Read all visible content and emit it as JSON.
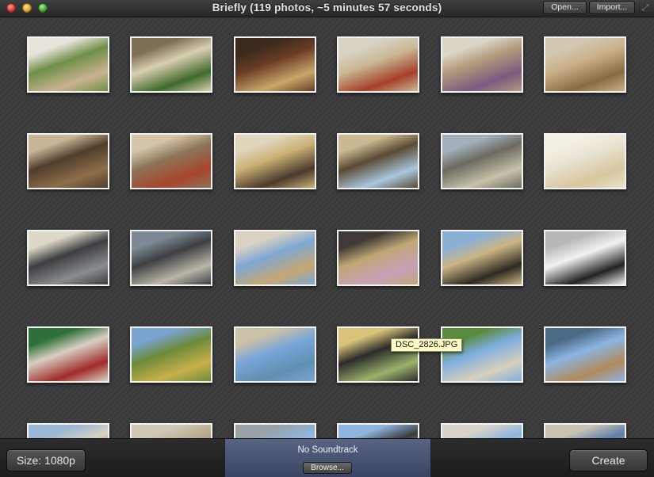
{
  "window": {
    "title": "Briefly (119 photos, ~5 minutes 57 seconds)",
    "open_label": "Open...",
    "import_label": "Import..."
  },
  "tooltip": "DSC_2826.JPG",
  "photos": [
    {
      "colors": [
        "#6f8f48",
        "#c9b390",
        "#e8e4dc"
      ]
    },
    {
      "colors": [
        "#d9cfb2",
        "#3f6a2a",
        "#7c6f55"
      ]
    },
    {
      "colors": [
        "#6a3c25",
        "#c8a76a",
        "#3c2a1d"
      ]
    },
    {
      "colors": [
        "#c9b894",
        "#a5402a",
        "#d8d2c4"
      ]
    },
    {
      "colors": [
        "#b19a7a",
        "#7a5a80",
        "#dcd6c8"
      ]
    },
    {
      "colors": [
        "#c9b089",
        "#8a6a42",
        "#d2c7b0"
      ]
    },
    {
      "colors": [
        "#4f3d2b",
        "#8e6e4a",
        "#c7b597"
      ]
    },
    {
      "colors": [
        "#8b7558",
        "#a8452d",
        "#d4c4ab"
      ]
    },
    {
      "colors": [
        "#cab175",
        "#4a3a2b",
        "#e0d6bd"
      ]
    },
    {
      "colors": [
        "#5a4a34",
        "#a9c7de",
        "#cbb993"
      ]
    },
    {
      "colors": [
        "#6c6a60",
        "#c8c2aa",
        "#a3b0bc"
      ]
    },
    {
      "colors": [
        "#e7e1cf",
        "#d8c69d",
        "#f3efe3"
      ]
    },
    {
      "colors": [
        "#3c3e40",
        "#8a8d90",
        "#ddd8c8"
      ]
    },
    {
      "colors": [
        "#3d3f42",
        "#b9b6a8",
        "#7d8a95"
      ]
    },
    {
      "colors": [
        "#7fa7d4",
        "#c6a774",
        "#d9d2c2"
      ]
    },
    {
      "colors": [
        "#bfa774",
        "#c8a0b8",
        "#3f3a35"
      ]
    },
    {
      "colors": [
        "#cbb585",
        "#2d2a22",
        "#8ab0d6"
      ]
    },
    {
      "colors": [
        "#f2f2f0",
        "#222222",
        "#b8b8b8"
      ]
    },
    {
      "colors": [
        "#d7d0c2",
        "#a02a2a",
        "#2f6f3a"
      ]
    },
    {
      "colors": [
        "#6c8a3a",
        "#c8b04a",
        "#7aa3cf"
      ]
    },
    {
      "colors": [
        "#7aa5d8",
        "#5f8fb0",
        "#c9c1a8"
      ]
    },
    {
      "colors": [
        "#2b2b2b",
        "#9ab26a",
        "#d9c37a"
      ]
    },
    {
      "colors": [
        "#7faedf",
        "#d8cfbd",
        "#5a8a3e"
      ]
    },
    {
      "colors": [
        "#8cb4e2",
        "#b08a5a",
        "#4a6a86"
      ]
    },
    {
      "colors": [
        "#d8d2c2",
        "#7a6a55",
        "#9bb7d4"
      ]
    },
    {
      "colors": [
        "#b7a98a",
        "#6a7a8a",
        "#cfc8b5"
      ]
    },
    {
      "colors": [
        "#8fb5df",
        "#d8d3c5",
        "#9aa2a8"
      ]
    },
    {
      "colors": [
        "#3a3a3a",
        "#d8d2c2",
        "#8fb5df"
      ]
    },
    {
      "colors": [
        "#8fb5df",
        "#c8c4b8",
        "#d7d3c8"
      ]
    },
    {
      "colors": [
        "#5f7ea6",
        "#8fb5df",
        "#c9c3b5"
      ]
    }
  ],
  "bottom": {
    "size_label": "Size: 1080p",
    "soundtrack_label": "No Soundtrack",
    "browse_label": "Browse...",
    "create_label": "Create"
  }
}
